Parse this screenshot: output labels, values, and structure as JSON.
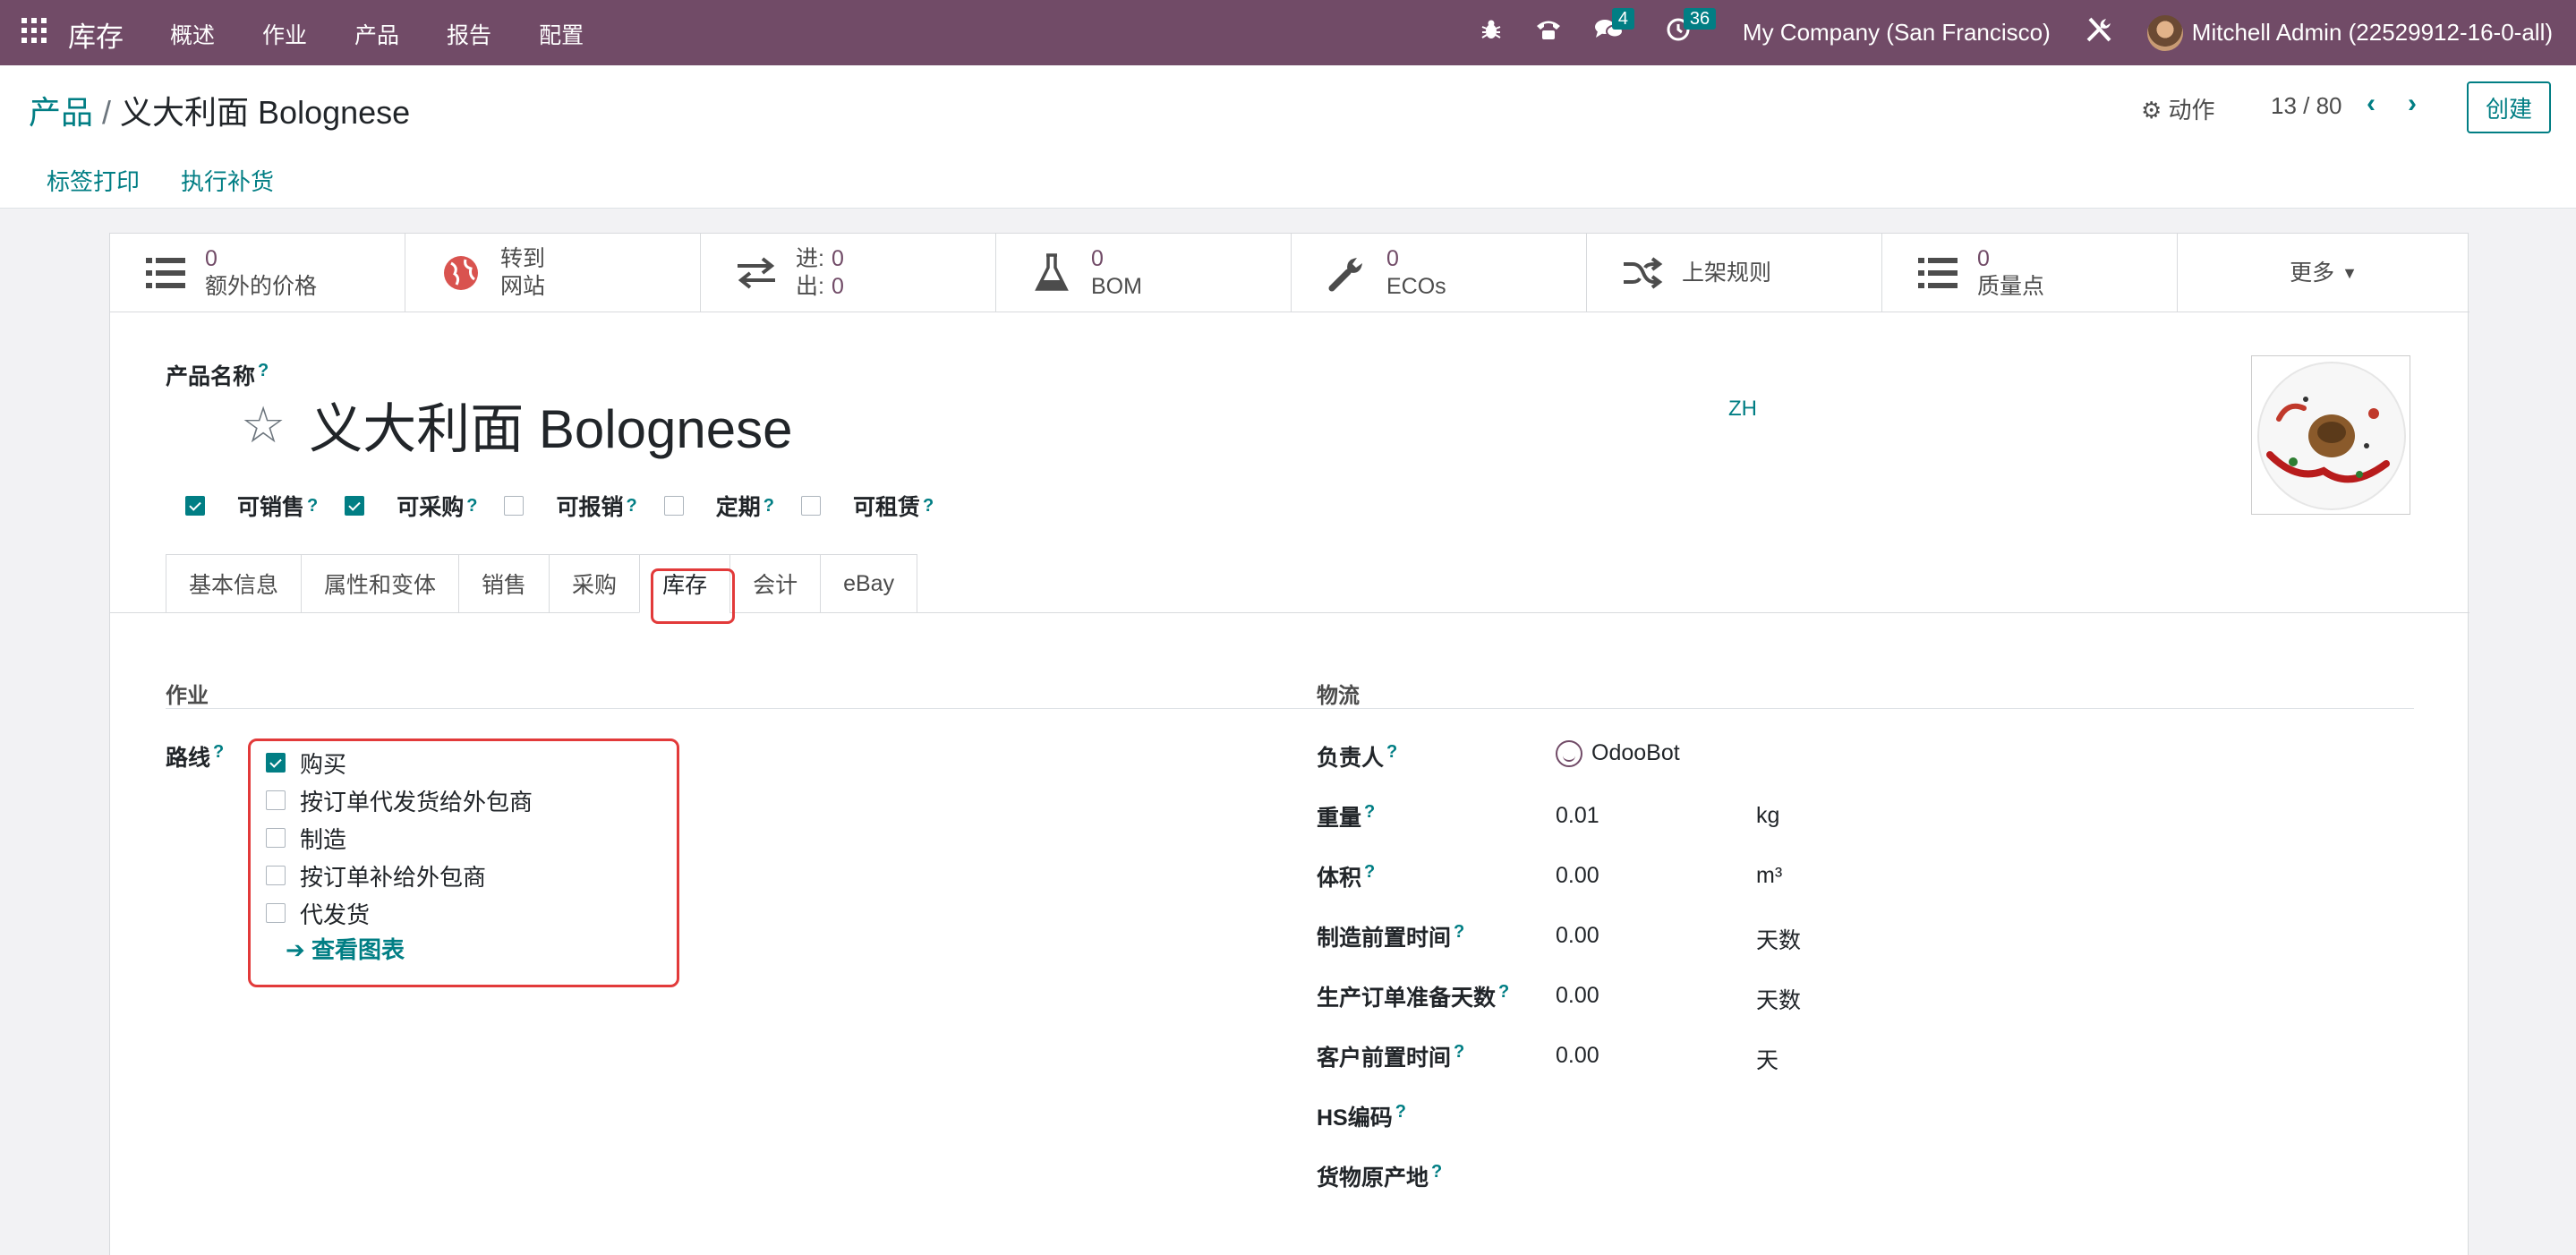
{
  "navbar": {
    "app_name": "库存",
    "menu": [
      "概述",
      "作业",
      "产品",
      "报告",
      "配置"
    ],
    "messages_count": "4",
    "activities_count": "36",
    "company": "My Company (San Francisco)",
    "user": "Mitchell Admin (22529912-16-0-all)"
  },
  "control": {
    "breadcrumb_parent": "产品",
    "breadcrumb_sep": "/",
    "breadcrumb_current": "义大利面 Bolognese",
    "action_label": "动作",
    "pager": "13 / 80",
    "create_label": "创建",
    "buttons": [
      "标签打印",
      "执行补货"
    ]
  },
  "smart_buttons": {
    "extra_price": {
      "value": "0",
      "label": "额外的价格"
    },
    "website": {
      "line1": "转到",
      "line2": "网站"
    },
    "inout": {
      "in_label": "进:",
      "in_value": "0",
      "out_label": "出:",
      "out_value": "0"
    },
    "bom": {
      "value": "0",
      "label": "BOM"
    },
    "ecos": {
      "value": "0",
      "label": "ECOs"
    },
    "putaway": {
      "label": "上架规则"
    },
    "quality": {
      "value": "0",
      "label": "质量点"
    },
    "more": "更多"
  },
  "product": {
    "name_label": "产品名称",
    "name": "义大利面 Bolognese",
    "lang": "ZH",
    "help": "?",
    "flags": [
      {
        "label": "可销售",
        "checked": true
      },
      {
        "label": "可采购",
        "checked": true
      },
      {
        "label": "可报销",
        "checked": false
      },
      {
        "label": "定期",
        "checked": false
      },
      {
        "label": "可租赁",
        "checked": false
      }
    ]
  },
  "tabs": [
    "基本信息",
    "属性和变体",
    "销售",
    "采购",
    "库存",
    "会计",
    "eBay"
  ],
  "operations": {
    "title": "作业",
    "routes_label": "路线",
    "routes": [
      {
        "label": "购买",
        "checked": true
      },
      {
        "label": "按订单代发货给外包商",
        "checked": false
      },
      {
        "label": "制造",
        "checked": false
      },
      {
        "label": "按订单补给外包商",
        "checked": false
      },
      {
        "label": "代发货",
        "checked": false
      }
    ],
    "flow_link": "查看图表"
  },
  "logistics": {
    "title": "物流",
    "responsible_label": "负责人",
    "responsible": "OdooBot",
    "fields": [
      {
        "label": "重量",
        "value": "0.01",
        "unit": "kg"
      },
      {
        "label": "体积",
        "value": "0.00",
        "unit": "m³"
      },
      {
        "label": "制造前置时间",
        "value": "0.00",
        "unit": "天数"
      },
      {
        "label": "生产订单准备天数",
        "value": "0.00",
        "unit": "天数"
      },
      {
        "label": "客户前置时间",
        "value": "0.00",
        "unit": "天"
      }
    ],
    "hs_label": "HS编码",
    "origin_label": "货物原产地"
  },
  "colors": {
    "brand": "#714b67",
    "accent": "#017e84",
    "highlight": "#e23a3a"
  }
}
